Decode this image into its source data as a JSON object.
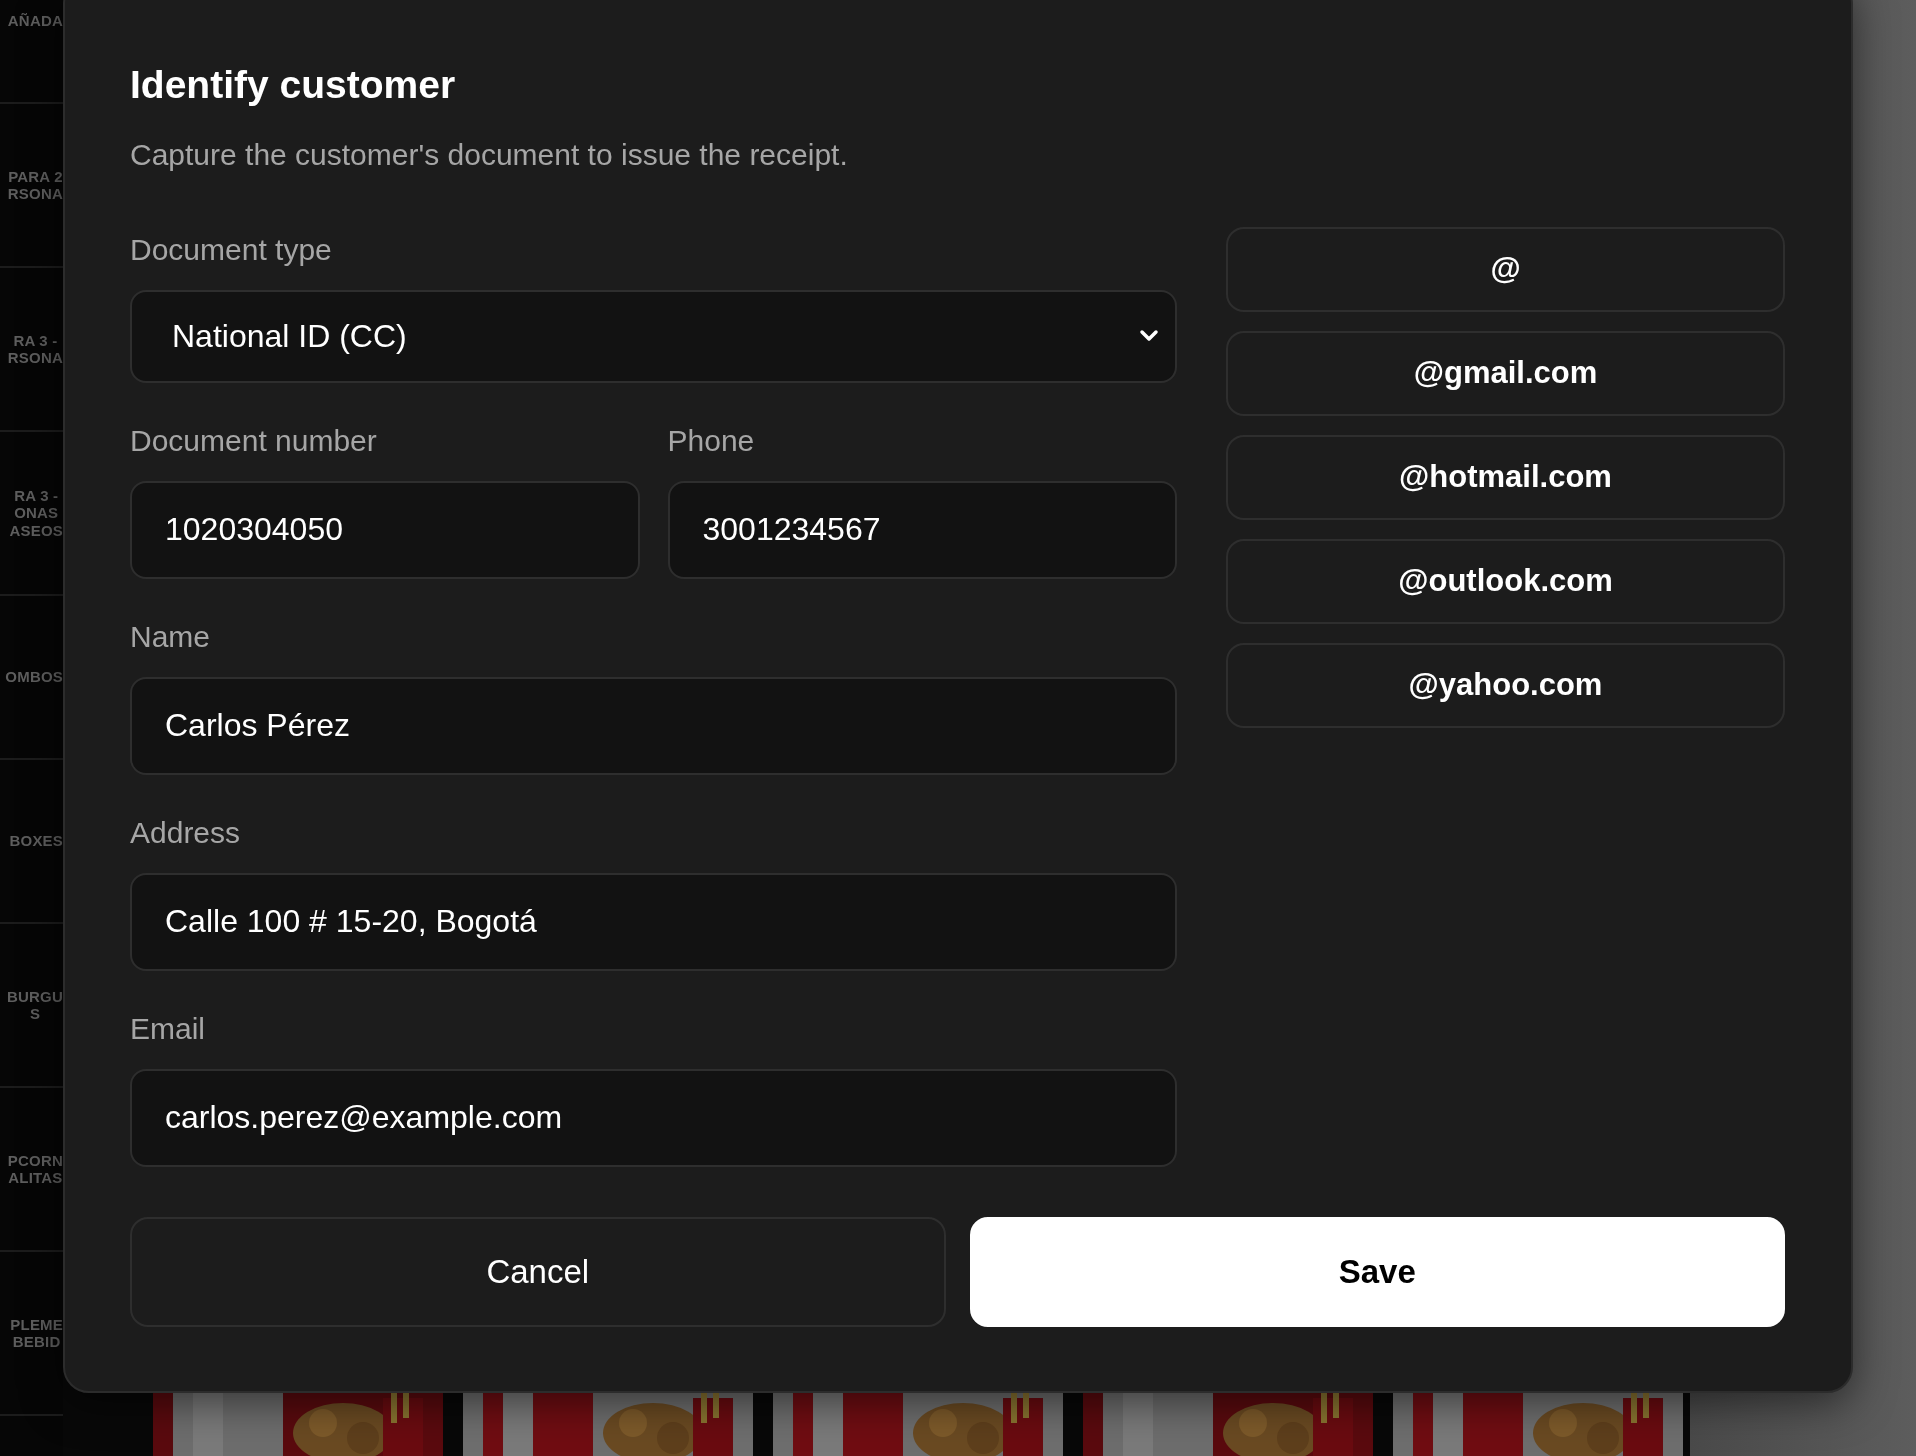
{
  "sidebar": {
    "items": [
      {
        "label": "AÑADA"
      },
      {
        "label": "PARA 2\nRSONA"
      },
      {
        "label": "RA 3 -\nRSONA"
      },
      {
        "label": "RA 3 -\nONAS\nASEOS"
      },
      {
        "label": "OMBOS"
      },
      {
        "label": "BOXES"
      },
      {
        "label": "BURGU\nS"
      },
      {
        "label": "PCORN\nALITAS"
      },
      {
        "label": "PLEME\nBEBID"
      }
    ]
  },
  "dialog": {
    "title": "Identify customer",
    "subtitle": "Capture the customer's document to issue the receipt.",
    "rows": [
      {
        "fields": [
          {
            "kind": "select",
            "label": "Document type",
            "value": "National ID (CC)"
          }
        ]
      },
      {
        "fields": [
          {
            "kind": "text",
            "label": "Document number",
            "value": "1020304050"
          },
          {
            "kind": "text",
            "label": "Phone",
            "value": "3001234567"
          }
        ]
      },
      {
        "fields": [
          {
            "kind": "text",
            "label": "Name",
            "value": "Carlos Pérez"
          }
        ]
      },
      {
        "fields": [
          {
            "kind": "text",
            "label": "Address",
            "value": "Calle 100 # 15-20, Bogotá"
          }
        ]
      },
      {
        "fields": [
          {
            "kind": "text",
            "label": "Email",
            "value": "carlos.perez@example.com"
          }
        ]
      }
    ],
    "email_domains": [
      "@",
      "@gmail.com",
      "@hotmail.com",
      "@outlook.com",
      "@yahoo.com"
    ],
    "buttons": [
      {
        "kind": "secondary",
        "label": "Cancel"
      },
      {
        "kind": "primary",
        "label": "Save"
      }
    ]
  }
}
